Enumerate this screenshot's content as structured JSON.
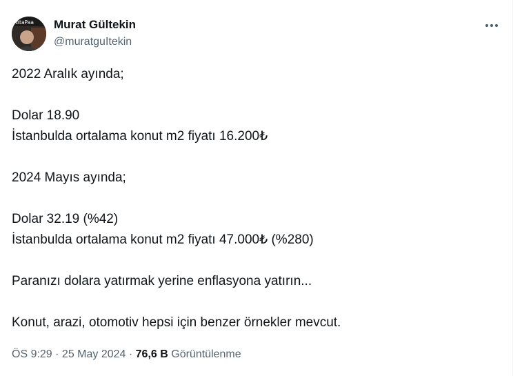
{
  "author": {
    "display_name": "Murat Gültekin",
    "handle": "@muratguItekin",
    "avatar_text": "AtaPaa"
  },
  "tweet": {
    "lines": [
      "2022 Aralık ayında;",
      "",
      "Dolar 18.90",
      "İstanbulda ortalama konut m2 fiyatı 16.200₺",
      "",
      "2024 Mayıs ayında;",
      "",
      "Dolar 32.19 (%42)",
      "İstanbulda ortalama konut m2 fiyatı 47.000₺ (%280)",
      "",
      "Paranızı dolara yatırmak yerine enflasyona yatırın...",
      "",
      "Konut, arazi, otomotiv hepsi için benzer örnekler mevcut."
    ]
  },
  "meta": {
    "time": "ÖS 9:29",
    "separator1": " · ",
    "date": "25 May 2024",
    "separator2": " · ",
    "views_count": "76,6 B",
    "views_label": "Görüntülenme"
  },
  "icons": {
    "more": "more-horizontal-icon"
  }
}
